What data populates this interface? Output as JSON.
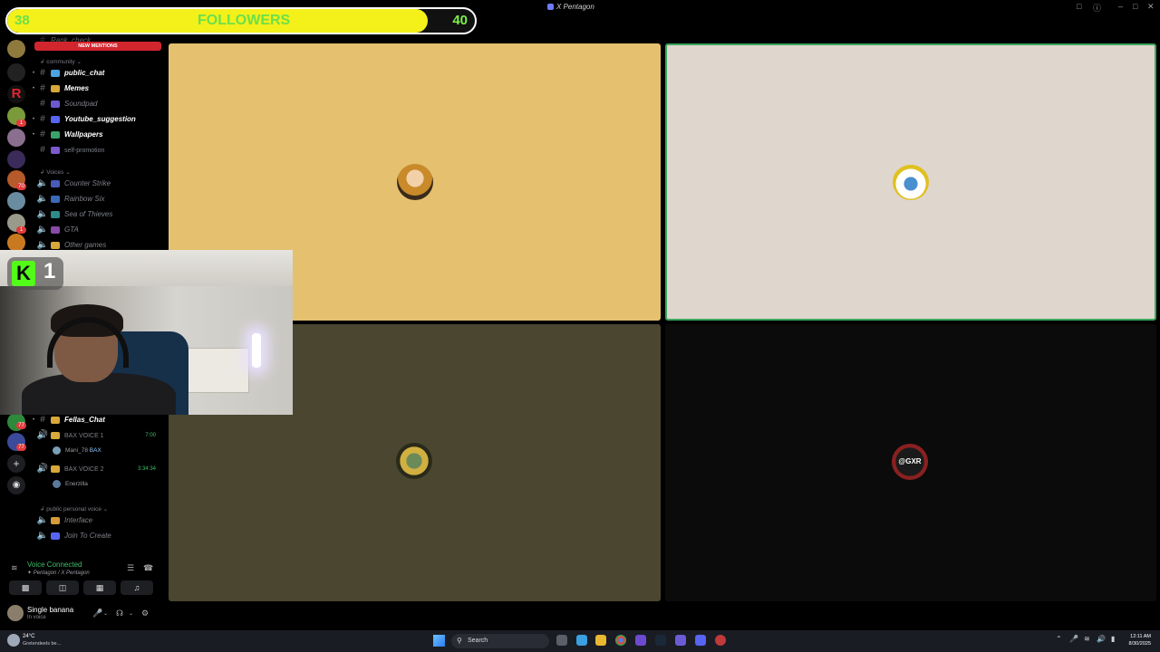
{
  "followers_bar": {
    "start": "38",
    "end": "40",
    "title": "FOLLOWERS",
    "progress_percent": 90
  },
  "window": {
    "title": "X Pentagon"
  },
  "sidebar": {
    "top_partial_channel": "Rank_check",
    "new_mentions": "NEW MENTIONS",
    "category_community": "community",
    "channels": [
      {
        "name": "public_chat",
        "style": "bold"
      },
      {
        "name": "Memes",
        "style": "bold"
      },
      {
        "name": "Soundpad",
        "style": "dim"
      },
      {
        "name": "Youtube_suggestion",
        "style": "bold"
      },
      {
        "name": "Wallpapers",
        "style": "bold"
      },
      {
        "name": "self-promotion",
        "style": "dim"
      }
    ],
    "category_voices": "Voices",
    "voice_channels": [
      "Counter Strike",
      "Rainbow Six",
      "Sea of Thieves",
      "GTA",
      "Other games"
    ],
    "fellas_chat": "Fellas_Chat",
    "bax_voice_1": "BAX VOICE 1",
    "bax_voice_1_timer": "7:00",
    "bax_voice_1_user": "Mani_78",
    "bax_voice_1_user_tag": "BAX",
    "bax_voice_2": "BAX VOICE 2",
    "bax_voice_2_timer": "3:34:34",
    "bax_voice_2_user": "Enerzilla",
    "category_public_personal": "public personal voice",
    "interface": "Interface",
    "join_to_create": "Join To Create"
  },
  "server_badges": [
    "1",
    "70",
    "1",
    "1",
    "77",
    "77"
  ],
  "voice_panel": {
    "status": "Voice Connected",
    "location": "✦ Pentagon / X Pentagon"
  },
  "user": {
    "name": "Single banana",
    "status": "In voice"
  },
  "kick": {
    "viewer_count": "1"
  },
  "tiles": [
    {
      "bg": "#e5c06f"
    },
    {
      "bg": "#dfd6cd"
    },
    {
      "bg": "#4a4630"
    },
    {
      "bg": "#0b0b0b",
      "pfp_text": "@GXR"
    }
  ],
  "taskbar": {
    "weather_temp": "24°C",
    "weather_desc": "Gretendeels be...",
    "search_placeholder": "Search",
    "time": "12:11 AM",
    "date": "8/30/2025"
  }
}
